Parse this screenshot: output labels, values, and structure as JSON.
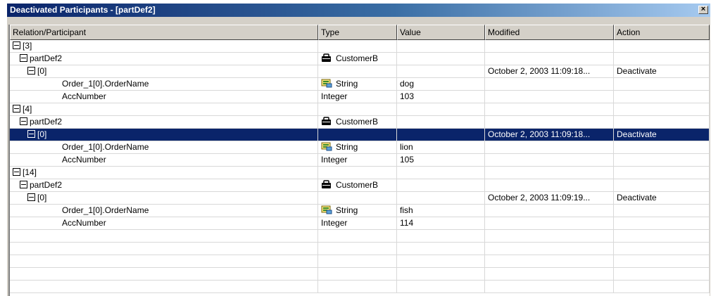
{
  "window": {
    "title": "Deactivated Participants - [partDef2]",
    "close_label": "×"
  },
  "columns": [
    "Relation/Participant",
    "Type",
    "Value",
    "Modified",
    "Action"
  ],
  "rows": [
    {
      "level": 0,
      "expander": true,
      "relation": "[3]",
      "type": "",
      "type_icon": "",
      "value": "",
      "modified": "",
      "action": ""
    },
    {
      "level": 1,
      "expander": true,
      "relation": "partDef2",
      "type": "CustomerB",
      "type_icon": "participant-icon",
      "value": "",
      "modified": "",
      "action": ""
    },
    {
      "level": 2,
      "expander": true,
      "relation": "[0]",
      "type": "",
      "type_icon": "",
      "value": "",
      "modified": "October 2, 2003 11:09:18...",
      "action": "Deactivate"
    },
    {
      "level": 3,
      "expander": false,
      "relation": "Order_1[0].OrderName",
      "type": "String",
      "type_icon": "string-icon",
      "value": "dog",
      "modified": "",
      "action": ""
    },
    {
      "level": 3,
      "expander": false,
      "relation": "AccNumber",
      "type": "Integer",
      "type_icon": "",
      "value": "103",
      "modified": "",
      "action": ""
    },
    {
      "level": 0,
      "expander": true,
      "relation": "[4]",
      "type": "",
      "type_icon": "",
      "value": "",
      "modified": "",
      "action": ""
    },
    {
      "level": 1,
      "expander": true,
      "relation": "partDef2",
      "type": "CustomerB",
      "type_icon": "participant-icon",
      "value": "",
      "modified": "",
      "action": ""
    },
    {
      "level": 2,
      "expander": true,
      "relation": "[0]",
      "type": "",
      "type_icon": "",
      "value": "",
      "modified": "October 2, 2003 11:09:18...",
      "action": "Deactivate",
      "selected": true
    },
    {
      "level": 3,
      "expander": false,
      "relation": "Order_1[0].OrderName",
      "type": "String",
      "type_icon": "string-icon",
      "value": "lion",
      "modified": "",
      "action": ""
    },
    {
      "level": 3,
      "expander": false,
      "relation": "AccNumber",
      "type": "Integer",
      "type_icon": "",
      "value": "105",
      "modified": "",
      "action": ""
    },
    {
      "level": 0,
      "expander": true,
      "relation": "[14]",
      "type": "",
      "type_icon": "",
      "value": "",
      "modified": "",
      "action": ""
    },
    {
      "level": 1,
      "expander": true,
      "relation": "partDef2",
      "type": "CustomerB",
      "type_icon": "participant-icon",
      "value": "",
      "modified": "",
      "action": ""
    },
    {
      "level": 2,
      "expander": true,
      "relation": "[0]",
      "type": "",
      "type_icon": "",
      "value": "",
      "modified": "October 2, 2003 11:09:19...",
      "action": "Deactivate"
    },
    {
      "level": 3,
      "expander": false,
      "relation": "Order_1[0].OrderName",
      "type": "String",
      "type_icon": "string-icon",
      "value": "fish",
      "modified": "",
      "action": ""
    },
    {
      "level": 3,
      "expander": false,
      "relation": "AccNumber",
      "type": "Integer",
      "type_icon": "",
      "value": "114",
      "modified": "",
      "action": ""
    }
  ],
  "empty_rows": 5,
  "colors": {
    "title_bar": "#0a246a",
    "selection": "#0a246a",
    "window_face": "#d4d0c8"
  }
}
